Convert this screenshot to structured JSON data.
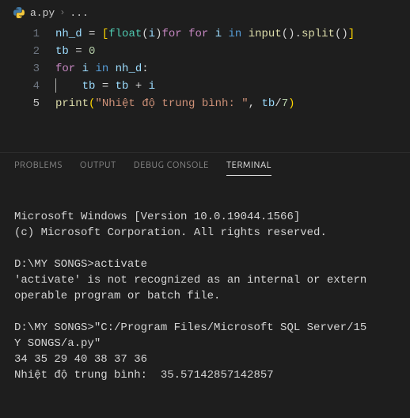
{
  "breadcrumb": {
    "filename": "a.py",
    "chevron": "›",
    "rest": "..."
  },
  "editor": {
    "lines": [
      {
        "num": "1"
      },
      {
        "num": "2"
      },
      {
        "num": "3"
      },
      {
        "num": "4"
      },
      {
        "num": "5"
      }
    ],
    "tokens": {
      "nh_d": "nh_d",
      "tb": "tb",
      "i": "i",
      "eq": " = ",
      "plus": " + ",
      "lbr": "[",
      "rbr": "]",
      "lpar": "(",
      "rpar": ")",
      "dot": ".",
      "comma": ", ",
      "slash": "/",
      "colon": ":",
      "float": "float",
      "input": "input",
      "split": "split",
      "print": "print",
      "for": "for",
      "in_kw": "in",
      "zero": "0",
      "seven": "7",
      "for_sp": "for ",
      "in_sp": " in ",
      "str": "\"Nhiệt độ trung bình: \""
    }
  },
  "panel": {
    "tabs": {
      "problems": "PROBLEMS",
      "output": "OUTPUT",
      "debug": "DEBUG CONSOLE",
      "terminal": "TERMINAL"
    },
    "terminal": {
      "l1": "Microsoft Windows [Version 10.0.19044.1566]",
      "l2": "(c) Microsoft Corporation. All rights reserved.",
      "blank": "",
      "l3": "D:\\MY SONGS>activate",
      "l4": "'activate' is not recognized as an internal or extern",
      "l5": "operable program or batch file.",
      "l6": "D:\\MY SONGS>\"C:/Program Files/Microsoft SQL Server/15",
      "l7": "Y SONGS/a.py\"",
      "l8": "34 35 29 40 38 37 36",
      "l9": "Nhiệt độ trung bình:  35.57142857142857"
    }
  }
}
